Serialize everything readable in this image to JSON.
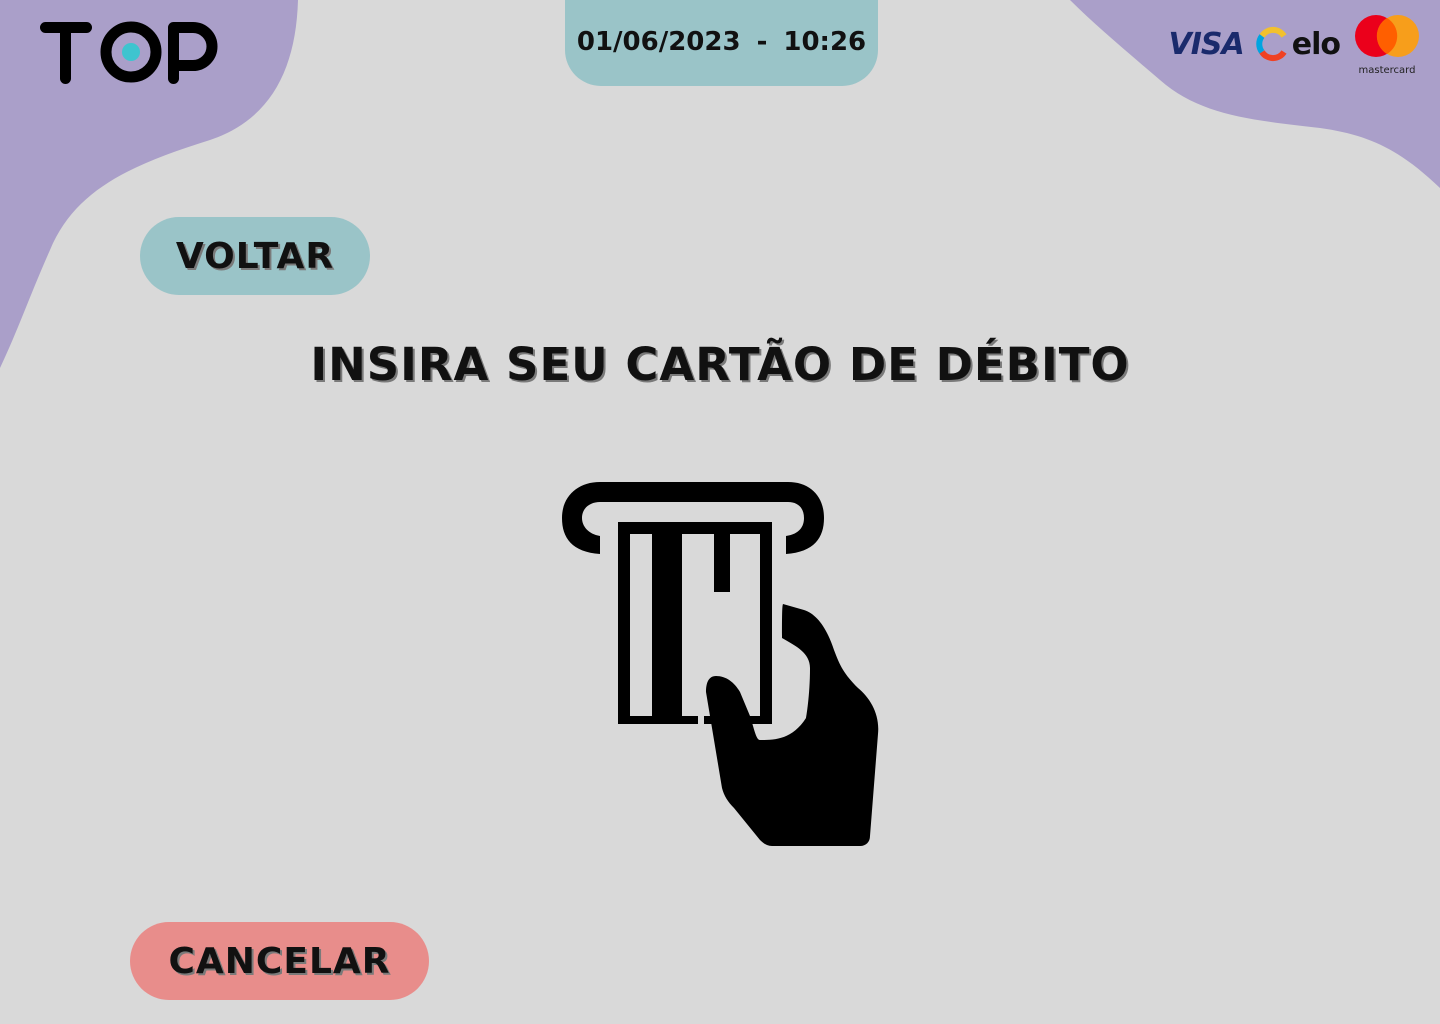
{
  "header": {
    "logo_text": "TOP",
    "date": "01/06/2023",
    "separator": "-",
    "time": "10:26",
    "card_brands": {
      "visa": "VISA",
      "elo": "elo",
      "mastercard": "mastercard"
    }
  },
  "actions": {
    "back_label": "VOLTAR",
    "cancel_label": "CANCELAR"
  },
  "main": {
    "title": "INSIRA SEU CARTÃO DE DÉBITO",
    "illustration_icon": "insert-card-icon"
  },
  "colors": {
    "background": "#d9d9d9",
    "blob": "#aa9fc9",
    "teal": "#9ac4c8",
    "cancel": "#e88d8b",
    "logo_dot": "#3ec4cf"
  }
}
